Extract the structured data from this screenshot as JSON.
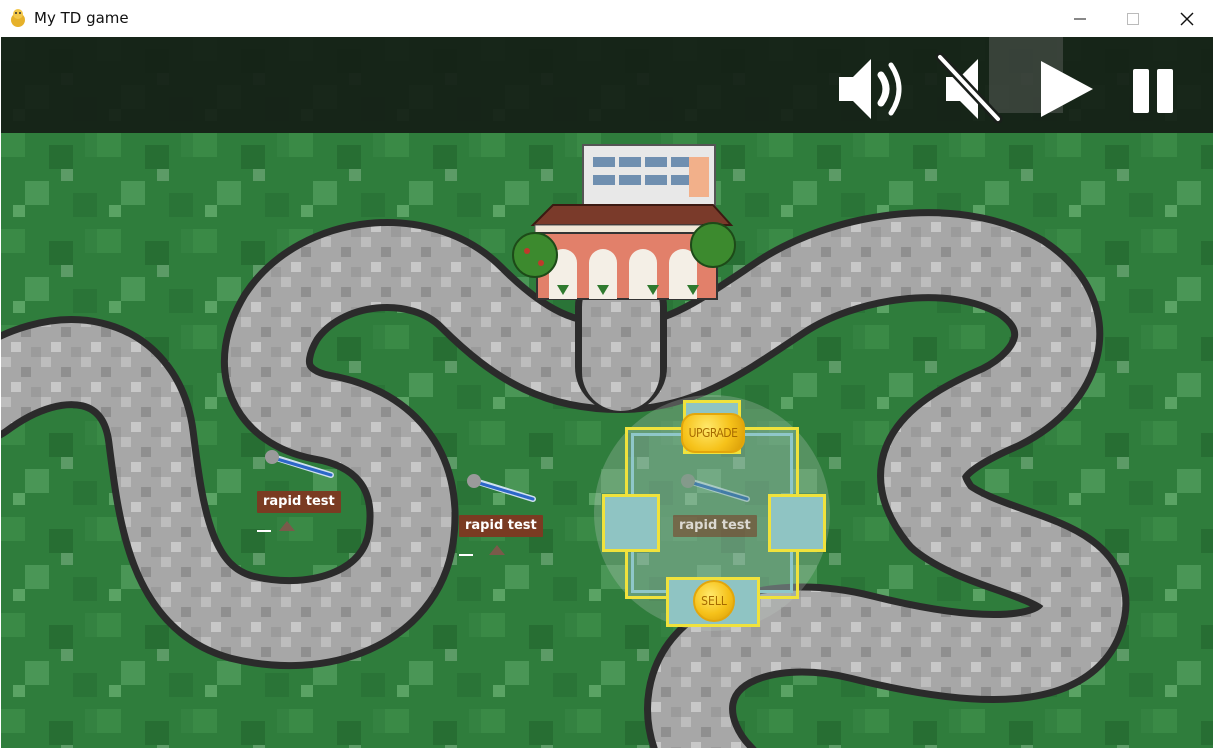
{
  "window": {
    "title": "My TD game",
    "controls": [
      "minimize",
      "maximize",
      "close"
    ]
  },
  "controls": {
    "items": [
      {
        "name": "sound-on",
        "icon": "speaker-icon"
      },
      {
        "name": "sound-off",
        "icon": "speaker-muted-icon"
      },
      {
        "name": "play",
        "icon": "play-icon"
      },
      {
        "name": "pause",
        "icon": "pause-icon"
      }
    ]
  },
  "towers": [
    {
      "label": "rapid test",
      "selected": false
    },
    {
      "label": "rapid test",
      "selected": false
    },
    {
      "label": "rapid test",
      "selected": true
    }
  ],
  "tower_menu": {
    "upgrade_label": "UPGRADE",
    "sell_label": "SELL"
  },
  "colors": {
    "grass": "#2f7d3c",
    "path": "#a9a9a9",
    "path_border": "#2b2b2b",
    "menu_border": "#f0e23c",
    "menu_slot": "#8fc4c3",
    "sign": "#7a3b22"
  }
}
